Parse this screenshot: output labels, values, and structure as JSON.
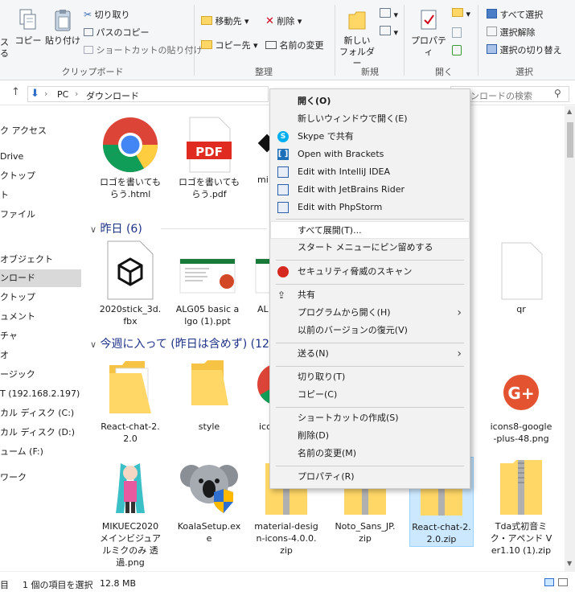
{
  "ribbon": {
    "clipboard": {
      "group_label": "クリップボード",
      "cut_partial": "ス",
      "cut_partial2": "る",
      "copy": "コピー",
      "paste": "貼り付け",
      "cut": "切り取り",
      "copy_path": "パスのコピー",
      "paste_shortcut": "ショートカットの貼り付け"
    },
    "organize": {
      "group_label": "整理",
      "move_to": "移動先",
      "copy_to": "コピー先",
      "delete": "削除",
      "rename": "名前の変更"
    },
    "new": {
      "group_label": "新規",
      "new_folder_l1": "新しい",
      "new_folder_l2": "フォルダー"
    },
    "open": {
      "group_label": "開く",
      "properties": "プロパティ"
    },
    "select": {
      "group_label": "選択",
      "select_all": "すべて選択",
      "select_none": "選択解除",
      "invert": "選択の切り替え"
    }
  },
  "address": {
    "pc": "PC",
    "folder": "ダウンロード",
    "search_placeholder": "ンロードの検索"
  },
  "nav": [
    {
      "label": "ク アクセス"
    },
    {
      "label": "Drive"
    },
    {
      "label": "クトップ"
    },
    {
      "label": "ト"
    },
    {
      "label": "ファイル"
    },
    {
      "label": "オブジェクト"
    },
    {
      "label": "ンロード"
    },
    {
      "label": "クトップ"
    },
    {
      "label": "ュメント"
    },
    {
      "label": "チャ"
    },
    {
      "label": "オ"
    },
    {
      "label": "ージック"
    },
    {
      "label": "T (192.168.2.197)"
    },
    {
      "label": "カル ディスク (C:)"
    },
    {
      "label": "カル ディスク (D:)"
    },
    {
      "label": "ューム (F:)"
    },
    {
      "label": "ワーク"
    }
  ],
  "top_files": [
    {
      "name": "ロゴを書いてもらう.html"
    },
    {
      "name": "ロゴを書いてもらう.pdf"
    },
    {
      "name": "mi"
    }
  ],
  "group_yesterday": {
    "header": "昨日 (6)",
    "files": [
      {
        "name": "2020stick_3d.fbx"
      },
      {
        "name": "ALG05 basic algo (1).ppt"
      },
      {
        "name": "AL"
      },
      {
        "name": "qr"
      }
    ]
  },
  "group_thisweek": {
    "header": "今週に入って (昨日は含めず) (12)",
    "files": [
      {
        "name": "React-chat-2.2.0"
      },
      {
        "name": "style"
      },
      {
        "name": "ico"
      },
      {
        "name": "icons8-google-plus-48.png"
      },
      {
        "name": "MIKUEC2020メインビジュアルミクのみ 透過.png"
      },
      {
        "name": "KoalaSetup.exe"
      },
      {
        "name": "material-design-icons-4.0.0.zip"
      },
      {
        "name": "Noto_Sans_JP.zip"
      },
      {
        "name": "React-chat-2.2.0.zip"
      },
      {
        "name": "Tda式初音ミク・アペンド Ver1.10 (1).zip"
      }
    ]
  },
  "pdf_badge": "PDF",
  "status": {
    "count_partial": "目",
    "selection": "1 個の項目を選択",
    "size": "12.8 MB"
  },
  "context_menu": {
    "items": [
      {
        "label": "開く(O)",
        "icon": "none"
      },
      {
        "label": "新しいウィンドウで開く(E)",
        "icon": "none"
      },
      {
        "label": "Skype で共有",
        "icon": "skype-icon"
      },
      {
        "label": "Open with Brackets",
        "icon": "brackets-icon"
      },
      {
        "label": "Edit with IntelliJ IDEA",
        "icon": "intellij-icon"
      },
      {
        "label": "Edit with JetBrains Rider",
        "icon": "rider-icon"
      },
      {
        "label": "Edit with PhpStorm",
        "icon": "phpstorm-icon"
      },
      {
        "label": "すべて展開(T)...",
        "icon": "none"
      },
      {
        "label": "スタート メニューにピン留めする",
        "icon": "none"
      },
      {
        "label": "セキュリティ脅威のスキャン",
        "icon": "security-scan-icon"
      },
      {
        "label": "共有",
        "icon": "share-icon"
      },
      {
        "label": "プログラムから開く(H)",
        "icon": "none"
      },
      {
        "label": "以前のバージョンの復元(V)",
        "icon": "none"
      },
      {
        "label": "送る(N)",
        "icon": "none"
      },
      {
        "label": "切り取り(T)",
        "icon": "none"
      },
      {
        "label": "コピー(C)",
        "icon": "none"
      },
      {
        "label": "ショートカットの作成(S)",
        "icon": "none"
      },
      {
        "label": "削除(D)",
        "icon": "none"
      },
      {
        "label": "名前の変更(M)",
        "icon": "none"
      },
      {
        "label": "プロパティ(R)",
        "icon": "none"
      }
    ]
  },
  "colors": {
    "selection_bg": "#cce8ff",
    "group_header": "#1e3287",
    "folder": "#ffd766",
    "menu_bg": "#f2f2f2"
  }
}
